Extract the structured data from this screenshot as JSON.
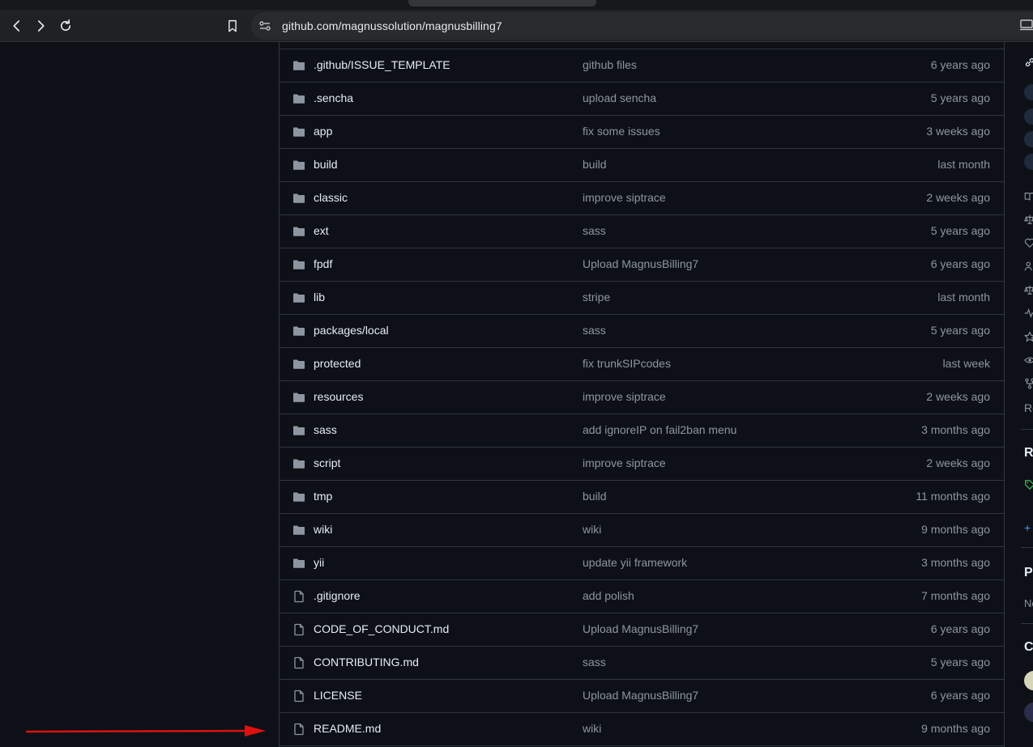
{
  "browser": {
    "url": "github.com/magnussolution/magnusbilling7"
  },
  "files": [
    {
      "type": "folder",
      "name": ".github/ISSUE_TEMPLATE",
      "message": "github files",
      "date": "6 years ago"
    },
    {
      "type": "folder",
      "name": ".sencha",
      "message": "upload sencha",
      "date": "5 years ago"
    },
    {
      "type": "folder",
      "name": "app",
      "message": "fix some issues",
      "date": "3 weeks ago"
    },
    {
      "type": "folder",
      "name": "build",
      "message": "build",
      "date": "last month"
    },
    {
      "type": "folder",
      "name": "classic",
      "message": "improve siptrace",
      "date": "2 weeks ago"
    },
    {
      "type": "folder",
      "name": "ext",
      "message": "sass",
      "date": "5 years ago"
    },
    {
      "type": "folder",
      "name": "fpdf",
      "message": "Upload MagnusBilling7",
      "date": "6 years ago"
    },
    {
      "type": "folder",
      "name": "lib",
      "message": "stripe",
      "date": "last month"
    },
    {
      "type": "folder",
      "name": "packages/local",
      "message": "sass",
      "date": "5 years ago"
    },
    {
      "type": "folder",
      "name": "protected",
      "message": "fix trunkSIPcodes",
      "date": "last week"
    },
    {
      "type": "folder",
      "name": "resources",
      "message": "improve siptrace",
      "date": "2 weeks ago"
    },
    {
      "type": "folder",
      "name": "sass",
      "message": "add ignoreIP on fail2ban menu",
      "date": "3 months ago"
    },
    {
      "type": "folder",
      "name": "script",
      "message": "improve siptrace",
      "date": "2 weeks ago"
    },
    {
      "type": "folder",
      "name": "tmp",
      "message": "build",
      "date": "11 months ago"
    },
    {
      "type": "folder",
      "name": "wiki",
      "message": "wiki",
      "date": "9 months ago"
    },
    {
      "type": "folder",
      "name": "yii",
      "message": "update yii framework",
      "date": "3 months ago"
    },
    {
      "type": "file",
      "name": ".gitignore",
      "message": "add polish",
      "date": "7 months ago"
    },
    {
      "type": "file",
      "name": "CODE_OF_CONDUCT.md",
      "message": "Upload MagnusBilling7",
      "date": "6 years ago"
    },
    {
      "type": "file",
      "name": "CONTRIBUTING.md",
      "message": "sass",
      "date": "5 years ago"
    },
    {
      "type": "file",
      "name": "LICENSE",
      "message": "Upload MagnusBilling7",
      "date": "6 years ago"
    },
    {
      "type": "file",
      "name": "README.md",
      "message": "wiki",
      "date": "9 months ago"
    }
  ],
  "sidebar": {
    "re_text": "Re",
    "releases_heading": "Re",
    "plus_text": "+",
    "packages_heading": "Pa",
    "no_text": "No",
    "contributors_heading": "Co"
  },
  "colors": {
    "background": "#0d1117",
    "border": "#30363d",
    "text": "#e6edf3",
    "muted": "#8d96a0",
    "folder_icon": "#8d96a0",
    "arrow": "#e01010",
    "tag_green": "#3fb950",
    "link_blue": "#4493f8"
  }
}
